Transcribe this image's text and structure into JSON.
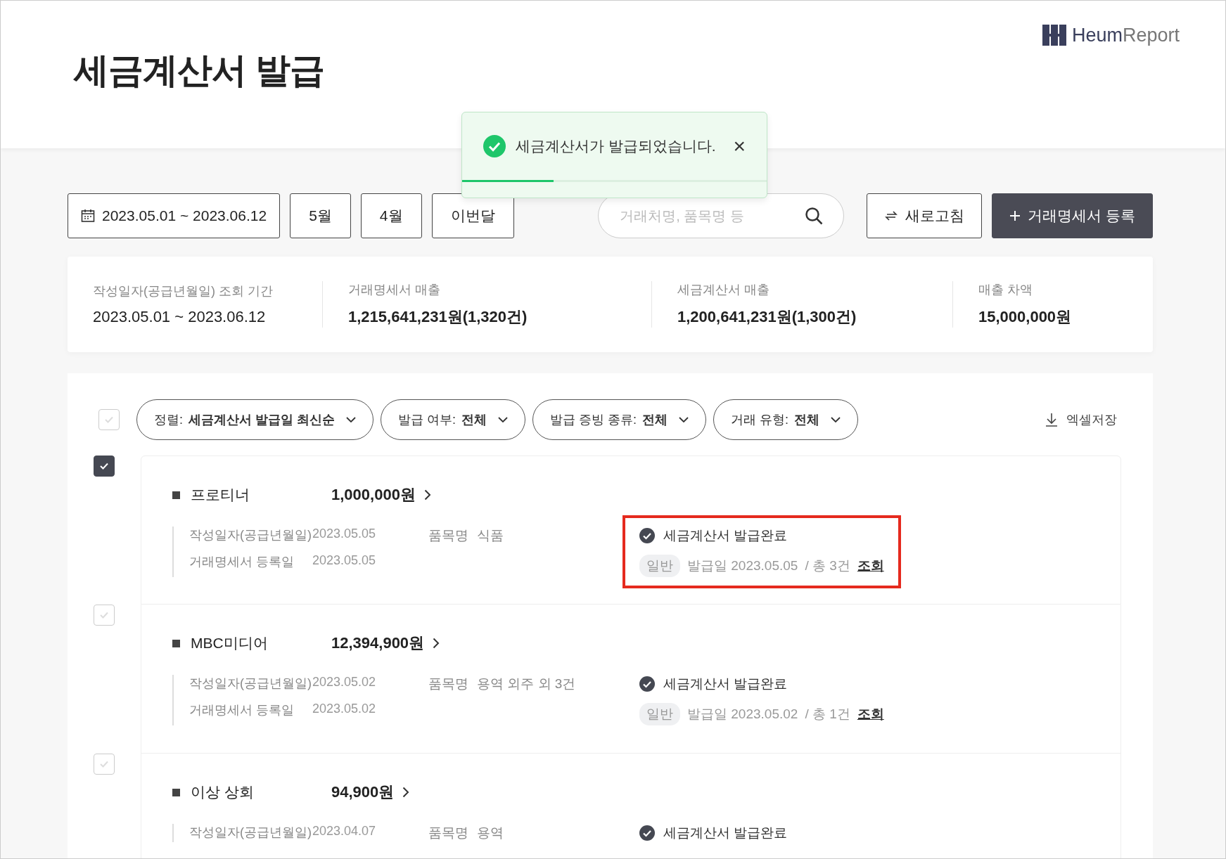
{
  "page_title": "세금계산서 발급",
  "logo": {
    "brand": "Heum",
    "product": "Report"
  },
  "toast": {
    "message": "세금계산서가 발급되었습니다.",
    "close": "×",
    "level": 0.3
  },
  "toolbar": {
    "date_range": "2023.05.01 ~ 2023.06.12",
    "period_buttons": [
      "5월",
      "4월",
      "이번달"
    ],
    "search": {
      "placeholder": "거래처명, 품목명 등"
    },
    "refresh": "새로고침",
    "register": "거래명세서 등록"
  },
  "summary": [
    {
      "label": "작성일자(공급년월일) 조회 기간",
      "value": "2023.05.01 ~ 2023.06.12",
      "bold": false
    },
    {
      "label": "거래명세서 매출",
      "value": "1,215,641,231원(1,320건)",
      "bold": true
    },
    {
      "label": "세금계산서 매출",
      "value": "1,200,641,231원(1,300건)",
      "bold": true
    },
    {
      "label": "매출 차액",
      "value": "15,000,000원",
      "bold": true
    }
  ],
  "filters": {
    "select_all_checked": false,
    "dropdowns": [
      {
        "label": "정렬:",
        "value": "세금계산서 발급일 최신순"
      },
      {
        "label": "발급 여부:",
        "value": "전체"
      },
      {
        "label": "발급 증빙 종류:",
        "value": "전체"
      },
      {
        "label": "거래 유형:",
        "value": "전체"
      }
    ],
    "export": "엑셀저장"
  },
  "items": [
    {
      "checked": true,
      "highlighted": true,
      "name": "프로티너",
      "amount": "1,000,000원",
      "date_label": "작성일자(공급년월일)",
      "date": "2023.05.05",
      "reg_label": "거래명세서 등록일",
      "reg_date": "2023.05.05",
      "product_label": "품목명",
      "product": "식품",
      "status": "세금계산서 발급완료",
      "type": "일반",
      "issued": "발급일 2023.05.05",
      "count": "/ 총 3건",
      "view": "조회"
    },
    {
      "checked": false,
      "highlighted": false,
      "name": "MBC미디어",
      "amount": "12,394,900원",
      "date_label": "작성일자(공급년월일)",
      "date": "2023.05.02",
      "reg_label": "거래명세서 등록일",
      "reg_date": "2023.05.02",
      "product_label": "품목명",
      "product": "용역 외주 외 3건",
      "status": "세금계산서 발급완료",
      "type": "일반",
      "issued": "발급일 2023.05.02",
      "count": "/ 총 1건",
      "view": "조회"
    },
    {
      "checked": false,
      "highlighted": false,
      "name": "이상 상회",
      "amount": "94,900원",
      "date_label": "작성일자(공급년월일)",
      "date": "2023.04.07",
      "product_label": "품목명",
      "product": "용역",
      "status": "세금계산서 발급완료"
    }
  ]
}
